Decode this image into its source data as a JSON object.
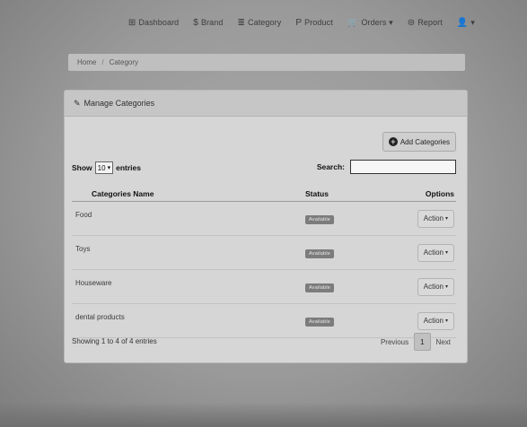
{
  "nav": {
    "items": [
      {
        "icon": "dashboard-icon",
        "glyph": "⊞",
        "label": "Dashboard"
      },
      {
        "icon": "brand-icon",
        "glyph": "$",
        "label": "Brand"
      },
      {
        "icon": "category-icon",
        "glyph": "≣",
        "label": "Category"
      },
      {
        "icon": "product-icon",
        "glyph": "P",
        "label": "Product"
      },
      {
        "icon": "orders-icon",
        "glyph": "🛒",
        "label": "Orders ▾"
      },
      {
        "icon": "report-icon",
        "glyph": "⊜",
        "label": "Report"
      },
      {
        "icon": "user-icon",
        "glyph": "👤",
        "label": "▾"
      }
    ]
  },
  "breadcrumb": {
    "home": "Home",
    "current": "Category"
  },
  "panel": {
    "title": "Manage Categories",
    "add_button": "Add Categories"
  },
  "table_controls": {
    "show_label": "Show",
    "page_size": "10",
    "entries_label": "entries",
    "search_label": "Search:"
  },
  "table": {
    "headers": {
      "name": "Categories Name",
      "status": "Status",
      "options": "Options"
    },
    "rows": [
      {
        "name": "Food",
        "status": "Available",
        "action": "Action"
      },
      {
        "name": "Toys",
        "status": "Available",
        "action": "Action"
      },
      {
        "name": "Houseware",
        "status": "Available",
        "action": "Action"
      },
      {
        "name": "dental products",
        "status": "Available",
        "action": "Action"
      }
    ]
  },
  "footer": {
    "info": "Showing 1 to 4 of 4 entries",
    "previous": "Previous",
    "page": "1",
    "next": "Next"
  }
}
